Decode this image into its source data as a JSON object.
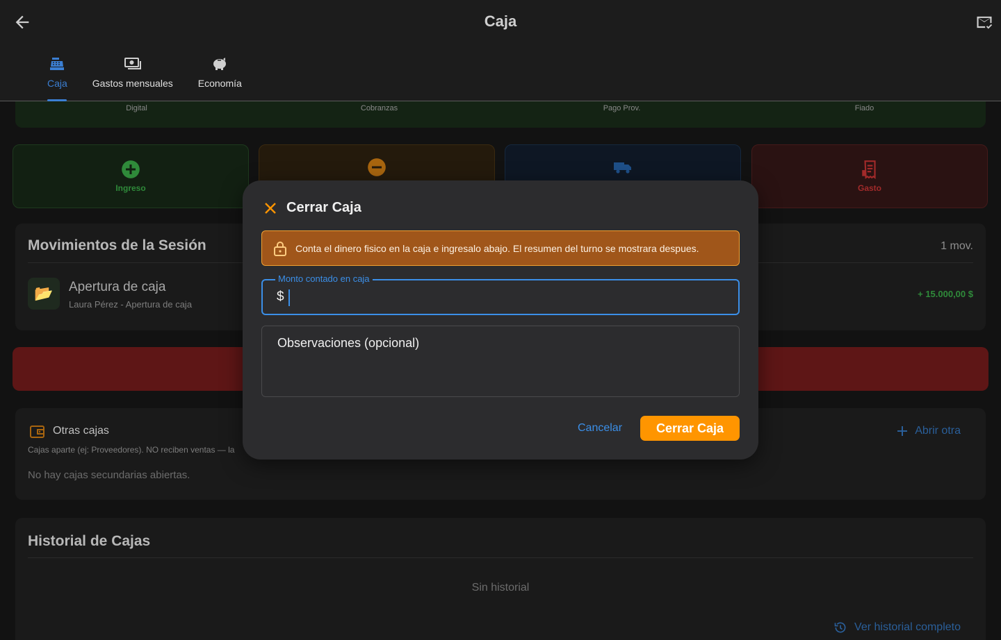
{
  "header": {
    "title": "Caja",
    "back_icon": "arrow-left-icon",
    "mail_icon": "mail-check-icon"
  },
  "tabs": [
    {
      "label": "Caja",
      "icon": "cash-register-icon",
      "active": true
    },
    {
      "label": "Gastos mensuales",
      "icon": "cash-icon",
      "active": false
    },
    {
      "label": "Economía",
      "icon": "piggy-bank-icon",
      "active": false
    }
  ],
  "summary": {
    "labels": [
      "Digital",
      "Cobranzas",
      "Pago Prov.",
      "Fiado"
    ]
  },
  "actions": {
    "ingreso": "Ingreso",
    "gasto": "Gasto"
  },
  "movements": {
    "title": "Movimientos de la Sesión",
    "count": "1 mov.",
    "items": [
      {
        "name": "Apertura de caja",
        "sub": "Laura Pérez - Apertura de caja",
        "amount": "+ 15.000,00 $"
      }
    ]
  },
  "other_registers": {
    "title": "Otras cajas",
    "subtitle": "Cajas aparte (ej: Proveedores). NO reciben ventas — la",
    "empty": "No hay cajas secundarias abiertas.",
    "open_label": "Abrir otra"
  },
  "history": {
    "title": "Historial de Cajas",
    "empty": "Sin historial",
    "link_label": "Ver historial completo"
  },
  "dialog": {
    "title": "Cerrar Caja",
    "alert": "Conta el dinero fisico en la caja e ingresalo abajo. El resumen del turno se mostrara despues.",
    "amount_label": "Monto contado en caja",
    "amount_prefix": "$",
    "amount_value": "",
    "notes_label": "Observaciones (opcional)",
    "cancel_label": "Cancelar",
    "confirm_label": "Cerrar Caja"
  },
  "colors": {
    "accent_blue": "#3b8fe8",
    "accent_orange": "#ff9500",
    "income_green": "#2f8a3a",
    "expense_red": "#a12a2a"
  }
}
